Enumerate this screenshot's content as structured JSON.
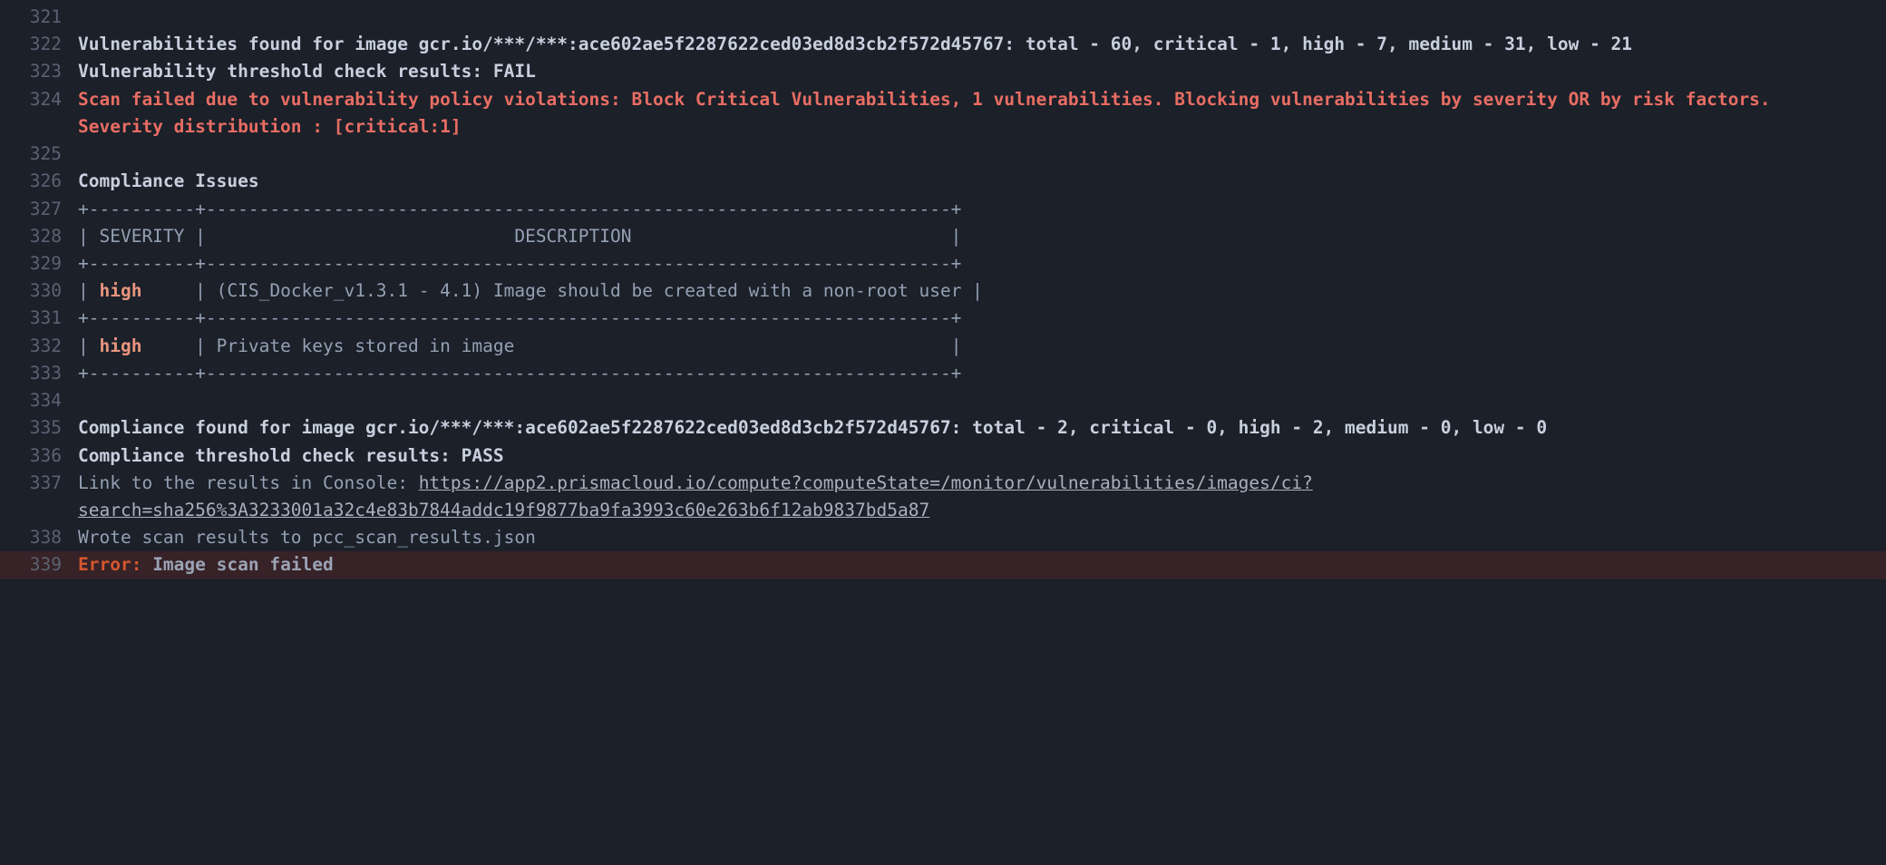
{
  "lines": [
    {
      "n": 321,
      "segs": [
        {
          "cls": "normal",
          "t": ""
        }
      ]
    },
    {
      "n": 322,
      "segs": [
        {
          "cls": "bold",
          "t": "Vulnerabilities found for image gcr.io/***/***:ace602ae5f2287622ced03ed8d3cb2f572d45767: total - 60, critical - 1, high - 7, medium - 31, low - 21"
        }
      ]
    },
    {
      "n": 323,
      "segs": [
        {
          "cls": "bold",
          "t": "Vulnerability threshold check results: FAIL"
        }
      ]
    },
    {
      "n": 324,
      "segs": [
        {
          "cls": "red",
          "t": "Scan failed due to vulnerability policy violations: Block Critical Vulnerabilities, 1 vulnerabilities. Blocking vulnerabilities by severity OR by risk factors. Severity distribution : [critical:1]"
        }
      ]
    },
    {
      "n": 325,
      "segs": [
        {
          "cls": "normal",
          "t": ""
        }
      ]
    },
    {
      "n": 326,
      "segs": [
        {
          "cls": "bold",
          "t": "Compliance Issues"
        }
      ]
    },
    {
      "n": 327,
      "segs": [
        {
          "cls": "normal",
          "t": "+----------+----------------------------------------------------------------------+"
        }
      ]
    },
    {
      "n": 328,
      "segs": [
        {
          "cls": "normal",
          "t": "| SEVERITY |                             DESCRIPTION                              |"
        }
      ]
    },
    {
      "n": 329,
      "segs": [
        {
          "cls": "normal",
          "t": "+----------+----------------------------------------------------------------------+"
        }
      ]
    },
    {
      "n": 330,
      "segs": [
        {
          "cls": "normal",
          "t": "| "
        },
        {
          "cls": "high",
          "t": "high"
        },
        {
          "cls": "normal",
          "t": "     | (CIS_Docker_v1.3.1 - 4.1) Image should be created with a non-root user |"
        }
      ]
    },
    {
      "n": 331,
      "segs": [
        {
          "cls": "normal",
          "t": "+----------+----------------------------------------------------------------------+"
        }
      ]
    },
    {
      "n": 332,
      "segs": [
        {
          "cls": "normal",
          "t": "| "
        },
        {
          "cls": "high",
          "t": "high"
        },
        {
          "cls": "normal",
          "t": "     | Private keys stored in image                                         |"
        }
      ]
    },
    {
      "n": 333,
      "segs": [
        {
          "cls": "normal",
          "t": "+----------+----------------------------------------------------------------------+"
        }
      ]
    },
    {
      "n": 334,
      "segs": [
        {
          "cls": "normal",
          "t": ""
        }
      ]
    },
    {
      "n": 335,
      "segs": [
        {
          "cls": "bold",
          "t": "Compliance found for image gcr.io/***/***:ace602ae5f2287622ced03ed8d3cb2f572d45767: total - 2, critical - 0, high - 2, medium - 0, low - 0"
        }
      ]
    },
    {
      "n": 336,
      "segs": [
        {
          "cls": "bold",
          "t": "Compliance threshold check results: PASS"
        }
      ]
    },
    {
      "n": 337,
      "segs": [
        {
          "cls": "normal",
          "t": "Link to the results in Console: "
        },
        {
          "cls": "lnk",
          "t": "https://app2.prismacloud.io/compute?computeState=/monitor/vulnerabilities/images/ci?search=sha256%3A3233001a32c4e83b7844addc19f9877ba9fa3993c60e263b6f12ab9837bd5a87"
        }
      ]
    },
    {
      "n": 338,
      "segs": [
        {
          "cls": "normal",
          "t": "Wrote scan results to pcc_scan_results.json"
        }
      ]
    },
    {
      "n": 339,
      "rowcls": "row-err",
      "segs": [
        {
          "cls": "errlbl",
          "t": "Error:"
        },
        {
          "cls": "errtxt",
          "t": " Image scan failed"
        }
      ]
    }
  ]
}
